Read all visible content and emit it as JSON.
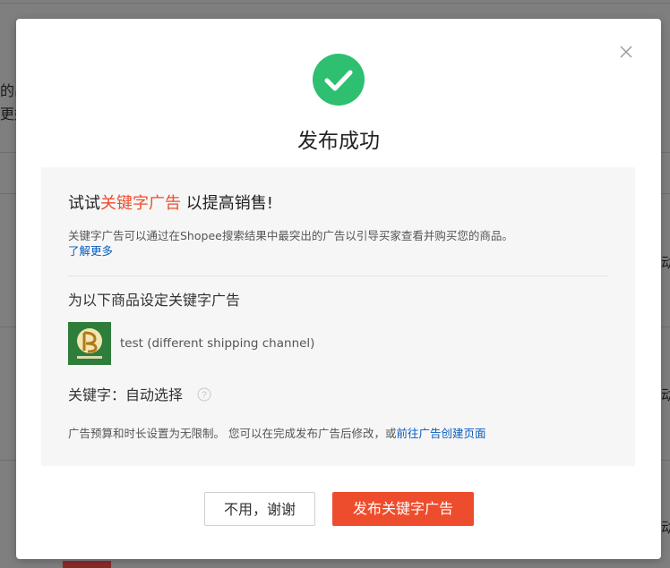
{
  "background": {
    "fragments": [
      "的出",
      "更好",
      "动",
      "动",
      "动"
    ]
  },
  "modal": {
    "title": "发布成功",
    "close_icon": "close-icon",
    "success_icon": "check-circle-icon",
    "panel": {
      "headline_prefix": "试试",
      "headline_highlight": "关键字广告",
      "headline_suffix": " 以提高销售!",
      "description": "关键字广告可以通过在Shopee搜索结果中最突出的广告以引导买家查看并购买您的商品。",
      "learn_more": "了解更多",
      "section_title": "为以下商品设定关键字广告",
      "product": {
        "name": "test (different shipping channel)"
      },
      "keyword_label": "关键字：自动选择",
      "help_icon": "question-circle-icon",
      "budget_note_text": "广告预算和时长设置为无限制。 您可以在完成发布广告后修改，或",
      "budget_note_link": "前往广告创建页面"
    },
    "buttons": {
      "cancel": "不用，谢谢",
      "primary": "发布关键字广告"
    }
  },
  "colors": {
    "accent": "#ee4d2d",
    "link": "#0a5cbd",
    "success": "#2fbf71"
  }
}
